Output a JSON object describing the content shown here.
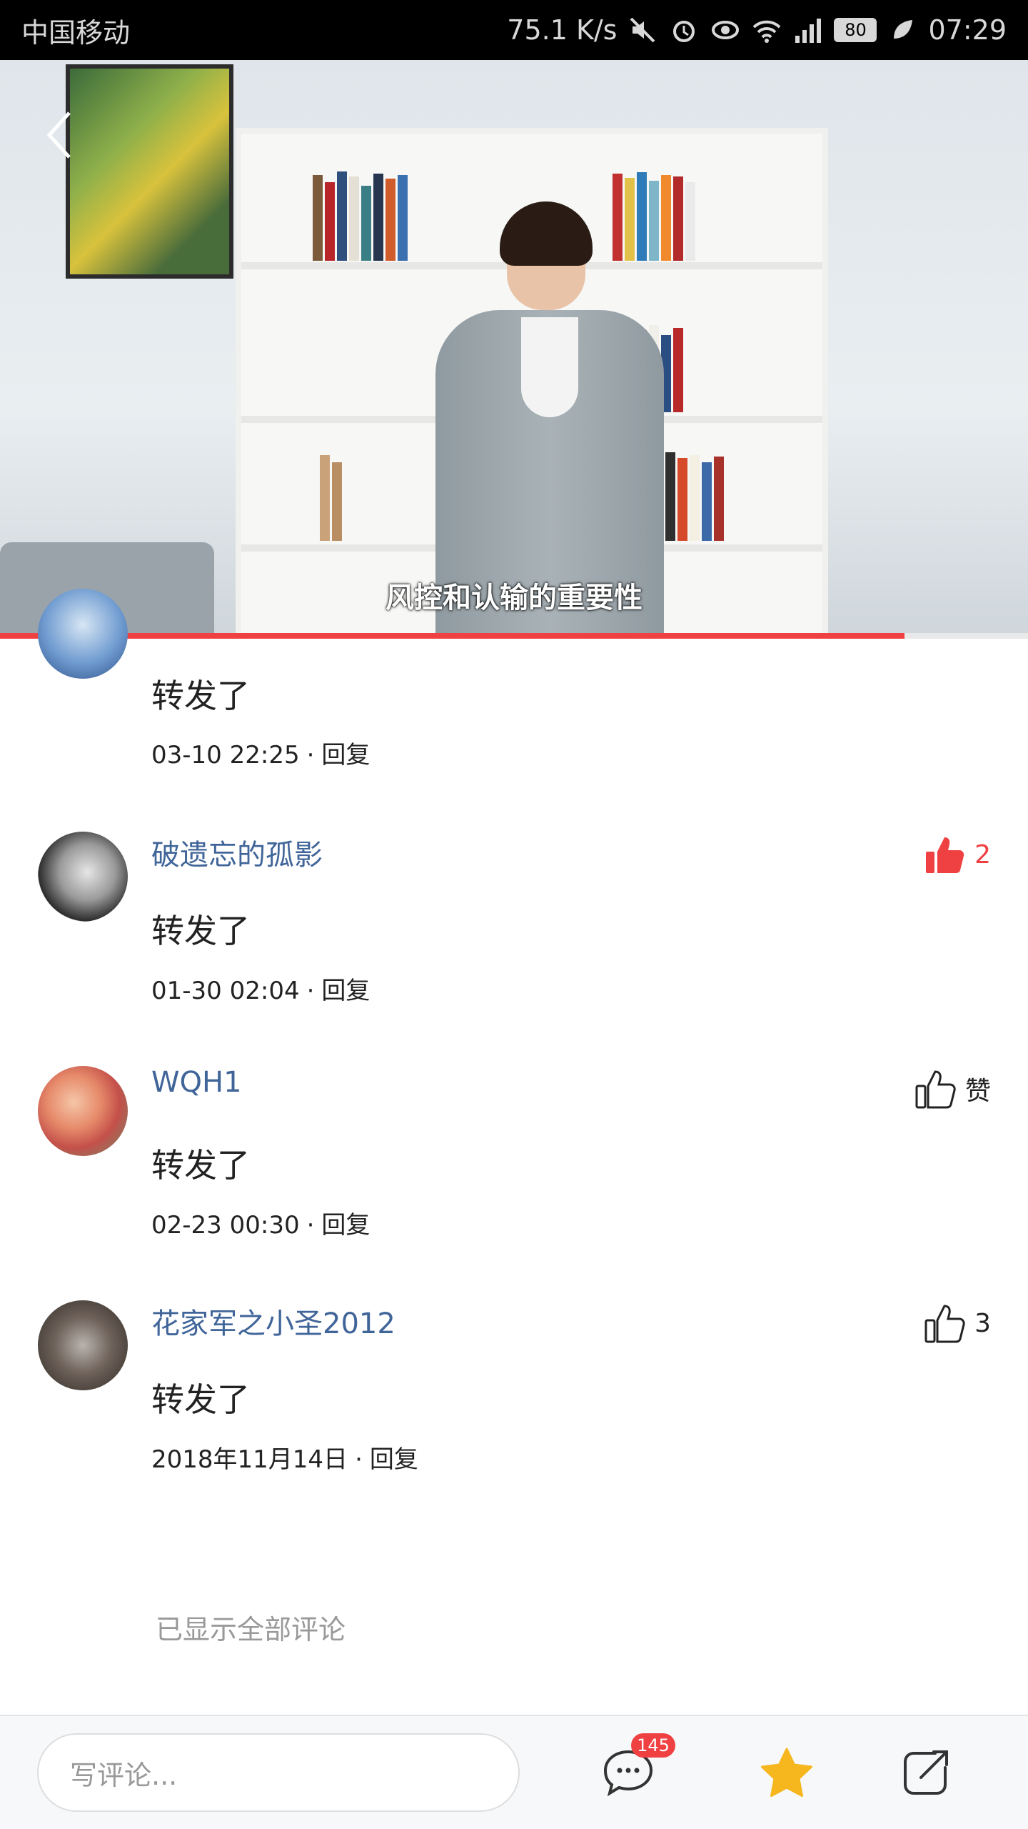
{
  "status_bar": {
    "carrier": "中国移动",
    "network_speed": "75.1 K/s",
    "battery": "80",
    "time": "07:29",
    "icons": [
      "mute-icon",
      "alarm-icon",
      "eye-icon",
      "wifi-icon",
      "signal-icon",
      "leaf-icon"
    ]
  },
  "video": {
    "subtitle": "风控和认输的重要性",
    "progress": 0.88
  },
  "comments": [
    {
      "username": "",
      "text": "转发了",
      "time": "03-10 22:25",
      "reply": "回复"
    },
    {
      "username": "破遗忘的孤影",
      "text": "转发了",
      "time": "01-30 02:04",
      "reply": "回复",
      "like": "2",
      "liked": true
    },
    {
      "username": "WQH1",
      "text": "转发了",
      "time": "02-23 00:30",
      "reply": "回复",
      "like": "赞"
    },
    {
      "username": "花家军之小圣2012",
      "text": "转发了",
      "time": "2018年11月14日",
      "reply": "回复",
      "like": "3"
    }
  ],
  "footer_note": "已显示全部评论",
  "bottom_bar": {
    "input_placeholder": "写评论...",
    "comment_count_badge": "145"
  },
  "colors": {
    "accent_red": "#f04142",
    "username_blue": "#406599",
    "star_yellow": "#f6b71e"
  }
}
